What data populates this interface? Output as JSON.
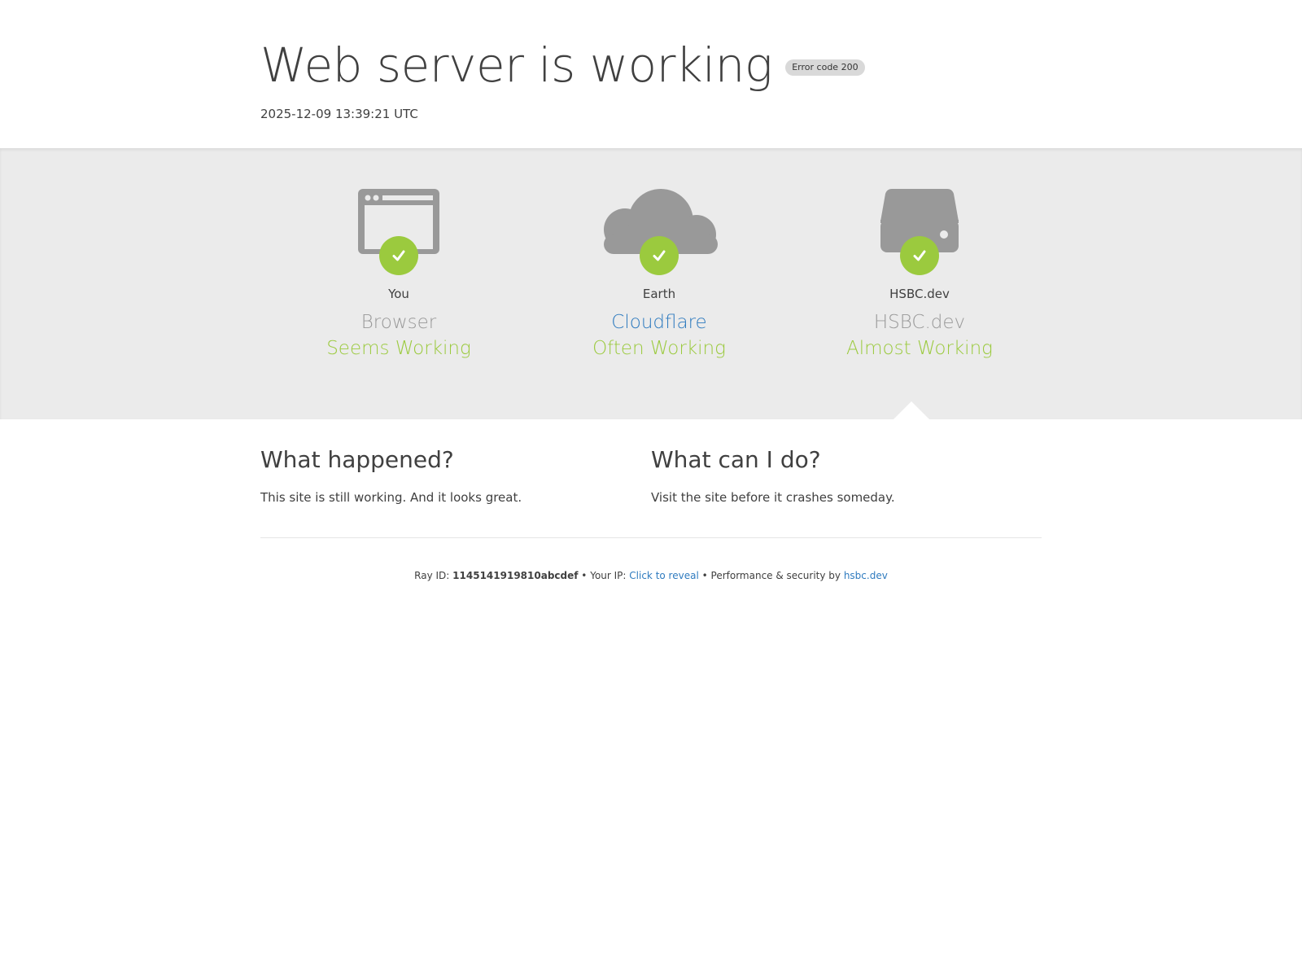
{
  "header": {
    "title": "Web server is working",
    "badge": "Error code 200",
    "timestamp": "2025-12-09 13:39:21 UTC"
  },
  "columns": [
    {
      "icon": "browser-window-icon",
      "name": "You",
      "type": "Browser",
      "status": "Seems Working",
      "status_icon": "check-icon"
    },
    {
      "icon": "cloud-icon",
      "name": "Earth",
      "type": "Cloudflare",
      "status": "Often Working",
      "status_icon": "check-icon"
    },
    {
      "icon": "server-drive-icon",
      "name": "HSBC.dev",
      "type": "HSBC.dev",
      "status": "Almost Working",
      "status_icon": "check-icon"
    }
  ],
  "what_happened": {
    "heading": "What happened?",
    "body": "This site is still working. And it looks great."
  },
  "what_can_i_do": {
    "heading": "What can I do?",
    "body": "Visit the site before it crashes someday."
  },
  "footer": {
    "ray_label": "Ray ID:",
    "ray_id": "1145141919810abcdef",
    "sep1": "•",
    "ip_label": "Your IP:",
    "ip_link": "Click to reveal",
    "sep2": "•",
    "perf_label": "Performance & security by",
    "perf_link": "hsbc.dev"
  },
  "colors": {
    "accent_green": "#9bca3e",
    "link_blue": "#2f7bbf",
    "icon_gray": "#999999",
    "band_gray": "#ebebeb"
  }
}
